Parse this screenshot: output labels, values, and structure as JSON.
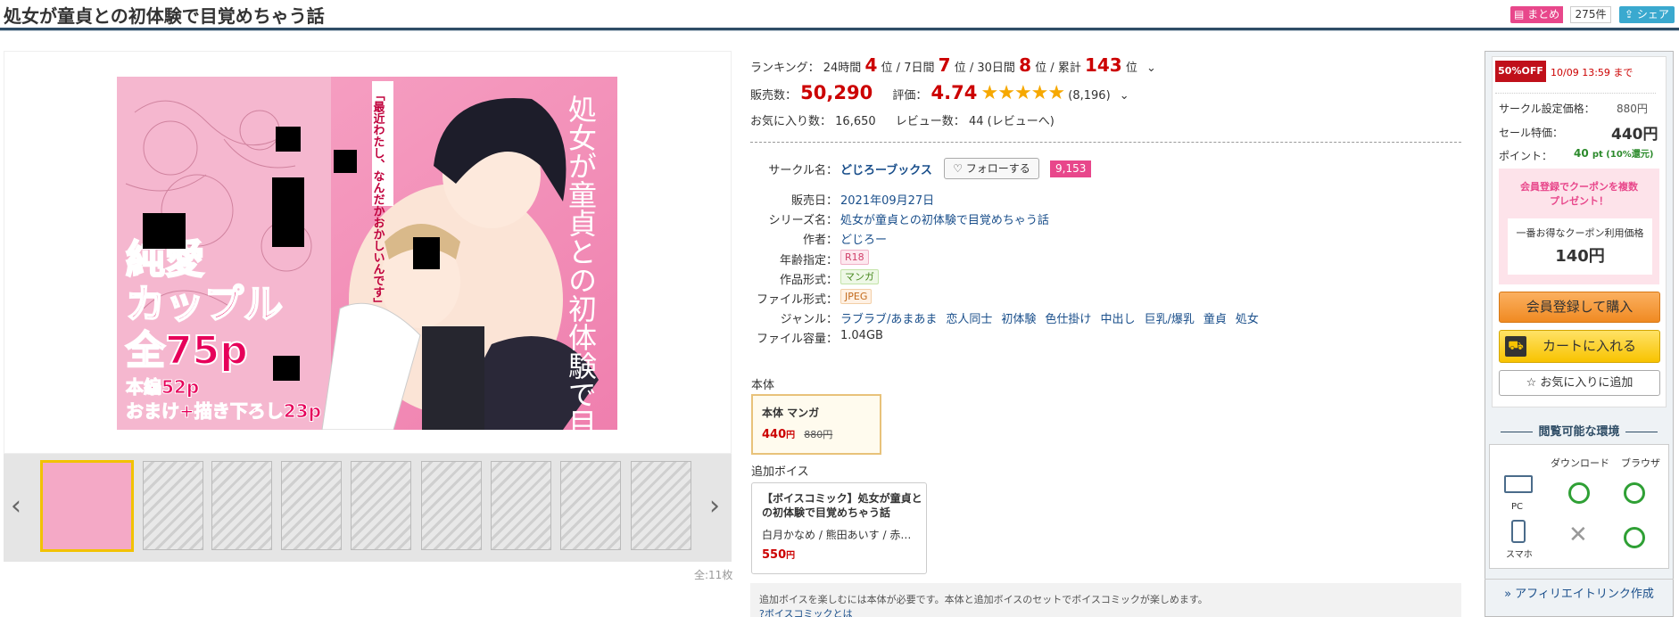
{
  "header": {
    "title": "処女が童貞との初体験で目覚めちゃう話",
    "matome_label": "まとめ",
    "matome_count": "275件",
    "share_label": "シェア"
  },
  "gallery": {
    "total": "全:11枚",
    "cover_text": {
      "vertical_title": "処女が童貞との初体験で目覚めちゃう話",
      "quote": "「最近わたし、なんだかおかしいんです」",
      "big_line1": "純愛",
      "big_line2": "カップル",
      "big_line3": "全75p",
      "small_line1": "本編52p",
      "small_line2": "おまけ+描き下ろし23p"
    }
  },
  "ranking": {
    "label": "ランキング：",
    "h24_label": "24時間",
    "h24_value": "4",
    "d7_label": "7日間",
    "d7_value": "7",
    "d30_label": "30日間",
    "d30_value": "8",
    "total_label": "累計",
    "total_value": "143",
    "unit": "位",
    "sep": "/"
  },
  "sales": {
    "label": "販売数：",
    "value": "50,290",
    "rating_label": "評価：",
    "rating_value": "4.74",
    "rating_stars": 4.74,
    "rating_count": "(8,196)"
  },
  "favorites": {
    "label": "お気に入り数：",
    "value": "16,650",
    "review_label": "レビュー数：",
    "review_value": "44",
    "review_link": "(レビューへ)"
  },
  "info": {
    "circle_label": "サークル名",
    "circle_value": "どじろーブックス",
    "follow_label": "フォローする",
    "follow_count": "9,153",
    "release_label": "販売日",
    "release_value": "2021年09月27日",
    "series_label": "シリーズ名",
    "series_value": "処女が童貞との初体験で目覚めちゃう話",
    "author_label": "作者",
    "author_value": "どじろー",
    "age_label": "年齢指定",
    "age_value": "R18",
    "format_label": "作品形式",
    "format_value": "マンガ",
    "file_label": "ファイル形式",
    "file_value": "JPEG",
    "genre_label": "ジャンル",
    "genres": [
      "ラブラブ/あまあま",
      "恋人同士",
      "初体験",
      "色仕掛け",
      "中出し",
      "巨乳/爆乳",
      "童貞",
      "処女"
    ],
    "size_label": "ファイル容量",
    "size_value": "1.04GB",
    "colon": "："
  },
  "editions": {
    "main_heading": "本体",
    "main_name": "本体 マンガ",
    "main_price": "440",
    "main_orig": "880",
    "yen": "円",
    "voice_heading": "追加ボイス",
    "voice_name": "【ボイスコミック】処女が童貞との初体験で目覚めちゃう話",
    "voice_cast": "白月かなめ / 熊田あいす / 赤…",
    "voice_price": "550"
  },
  "notice": {
    "text": "追加ボイスを楽しむには本体が必要です。本体と追加ボイスのセットでボイスコミックが楽しめます。",
    "link": "ボイスコミックとは"
  },
  "side": {
    "off_badge": "50%OFF",
    "deadline": "10/09 13:59 まで",
    "list_price_label": "サークル設定価格：",
    "list_price": "880円",
    "sale_label": "セール特価：",
    "sale_price": "440円",
    "point_label": "ポイント：",
    "point_value": "40",
    "point_unit": "pt (10%還元)",
    "coupon_line1": "会員登録でクーポンを複数",
    "coupon_line2": "プレゼント！",
    "coupon_best": "一番お得なクーポン利用価格",
    "coupon_price": "140円",
    "buy_label": "会員登録して購入",
    "cart_label": "カートに入れる",
    "fav_label": "お気に入りに追加",
    "env_title": "閲覧可能な環境",
    "env_download": "ダウンロード",
    "env_browser": "ブラウザ",
    "env_pc": "PC",
    "env_phone": "スマホ",
    "affiliate": "アフィリエイトリンク作成"
  },
  "colors": {
    "accent_red": "#c00000",
    "brand_pink": "#e8478b",
    "buy_orange": "#f08a22",
    "cart_yellow": "#f8c300",
    "star": "#f6a800"
  }
}
